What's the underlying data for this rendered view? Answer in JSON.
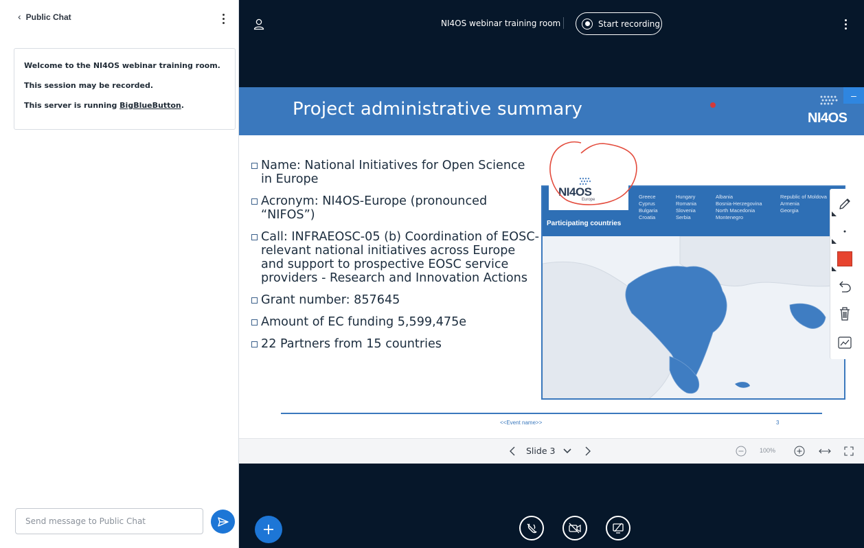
{
  "chat": {
    "back_label": "Public Chat",
    "welcome": {
      "line1": "Welcome to the NI4OS webinar training room.",
      "line2": "This session may be recorded.",
      "line3_prefix": "This server is running ",
      "line3_link": "BigBlueButton",
      "line3_suffix": "."
    },
    "input_placeholder": "Send message to Public Chat",
    "input_value": ""
  },
  "topbar": {
    "meeting_title": "NI4OS webinar training room",
    "record_label": "Start recording"
  },
  "slide": {
    "title": "Project administrative summary",
    "logo_text": "NI4OS",
    "bullets": [
      "Name: National Initiatives for Open Science in Europe",
      "Acronym: NI4OS-Europe (pronounced “NIFOS”)",
      "Call: INFRAEOSC-05 (b) Coordination of EOSC-relevant national initiatives across Europe and support to prospective EOSC service providers - Research and Innovation Actions",
      "Grant number: 857645",
      "Amount of EC funding 5,599,475e",
      "22 Partners from 15 countries"
    ],
    "map": {
      "legend_label": "Participating countries",
      "logo_text": "NI4OS",
      "logo_sub": "Europe",
      "countries_col1": [
        "Greece",
        "Cyprus",
        "Bulgaria",
        "Croatia"
      ],
      "countries_col2": [
        "Hungary",
        "Romania",
        "Slovenia",
        "Serbia"
      ],
      "countries_col3": [
        "Albania",
        "Bosnia-Herzegovina",
        "North Macedonia",
        "Montenegro"
      ],
      "countries_col4": [
        "Republic of Moldova",
        "Armenia",
        "Georgia"
      ]
    },
    "footer_event": "<<Event name>>",
    "footer_page": "3"
  },
  "colors": {
    "accent": "#1d76d6",
    "slide_blue": "#3a78bd",
    "background": "#06172a",
    "annotation_red": "#e34b3c",
    "color_swatch": "#e7442f"
  },
  "slide_nav": {
    "current_slide": "Slide 3",
    "zoom": "100%"
  },
  "icons": {
    "user_list": "user-icon",
    "send": "send-icon",
    "actions": "plus-icon",
    "tools": [
      "pencil-icon",
      "dot-size-icon",
      "color-swatch-icon",
      "undo-icon",
      "trash-icon",
      "multi-user-whiteboard-icon"
    ],
    "bottom_bar": [
      "mute-microphone-icon",
      "camera-off-icon",
      "screenshare-off-icon"
    ]
  }
}
